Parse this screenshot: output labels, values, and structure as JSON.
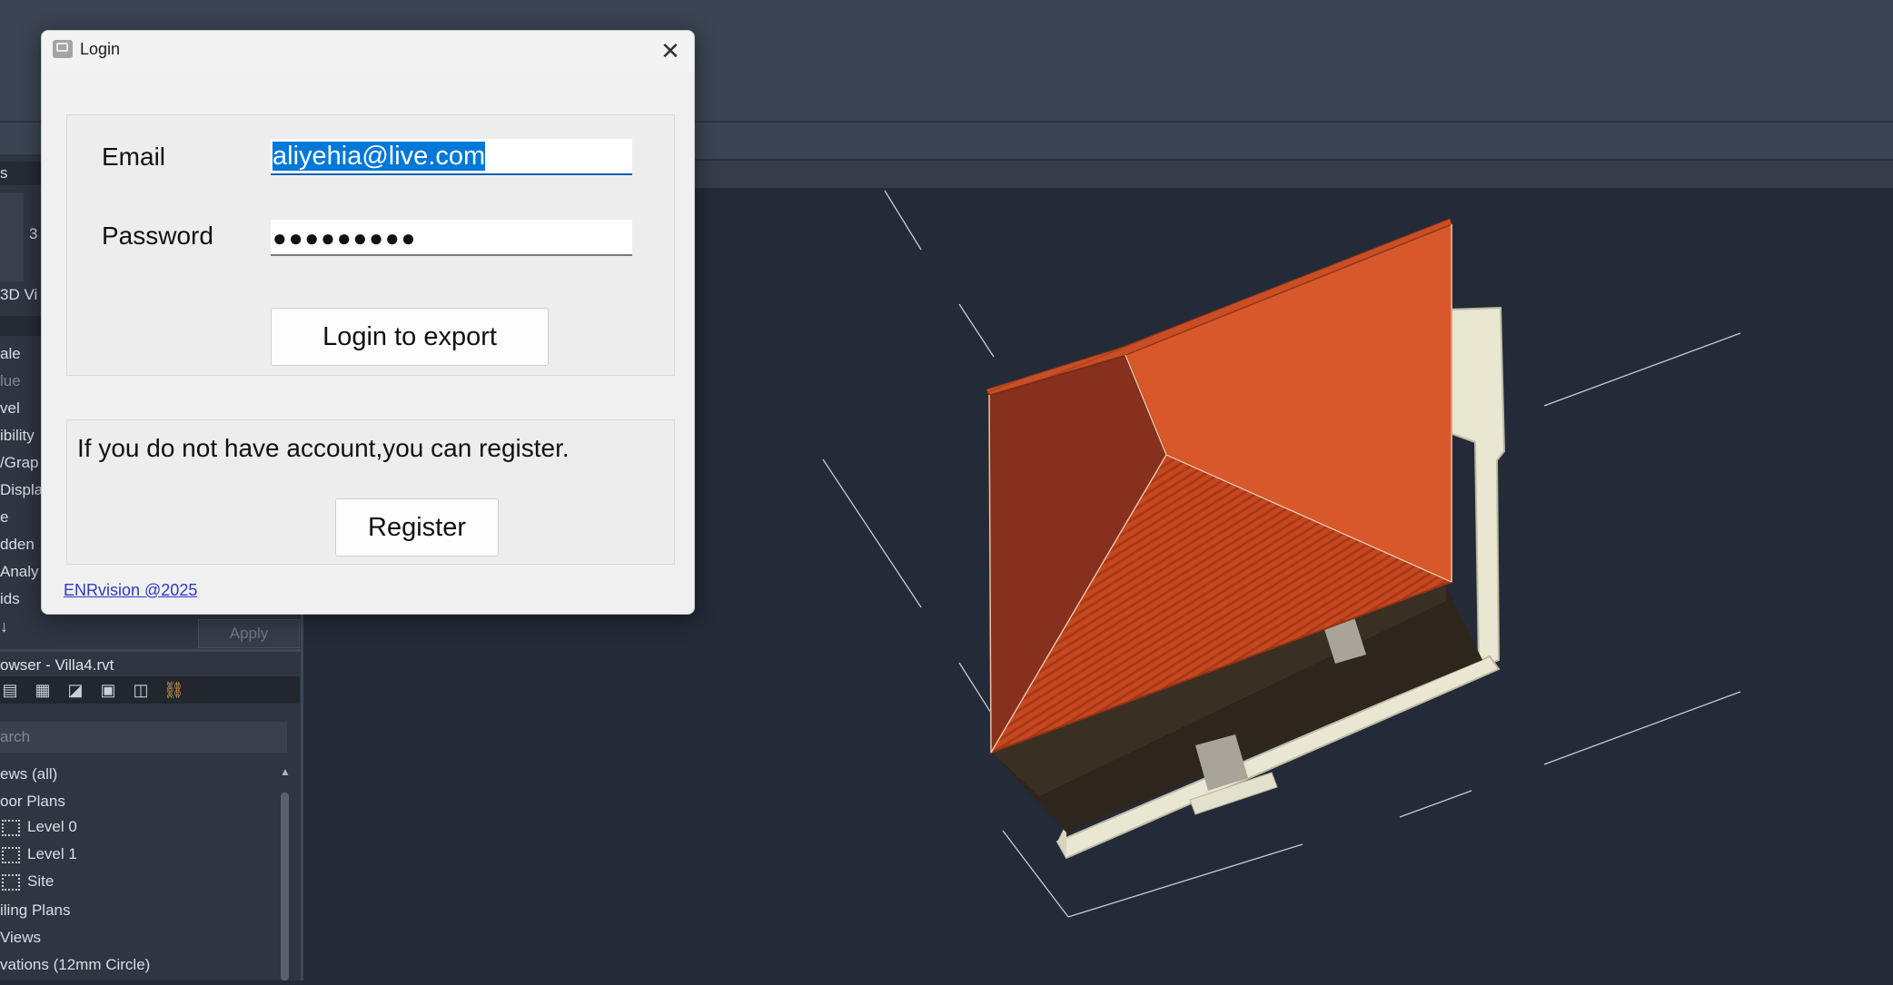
{
  "dialog": {
    "title": "Login",
    "email_label": "Email",
    "email_value": "aliyehia@live.com",
    "password_label": "Password",
    "password_mask": "●●●●●●●●●",
    "login_button": "Login to export",
    "register_prompt": "If you do not have account,you can register.",
    "register_button": "Register",
    "footer_link": "ENRvision @2025"
  },
  "revit": {
    "properties_rows": [
      "3D Vi",
      "ale",
      "lue",
      "vel",
      "ibility",
      "/Grap",
      "Displa",
      "e",
      "dden",
      "Analy",
      "ids"
    ],
    "view_card_number": "3",
    "apply_label": "Apply",
    "browser_title": "owser - Villa4.rvt",
    "search_placeholder": "arch",
    "tree": {
      "views_all": "ews (all)",
      "floor_plans": "oor Plans",
      "level0": "Level 0",
      "level1": "Level 1",
      "site": "Site",
      "ceiling_plans": "iling Plans",
      "views_3d": " Views",
      "elevations": "vations (12mm Circle)"
    },
    "panel_header_s": "s",
    "sort_icon_label": "↓"
  }
}
